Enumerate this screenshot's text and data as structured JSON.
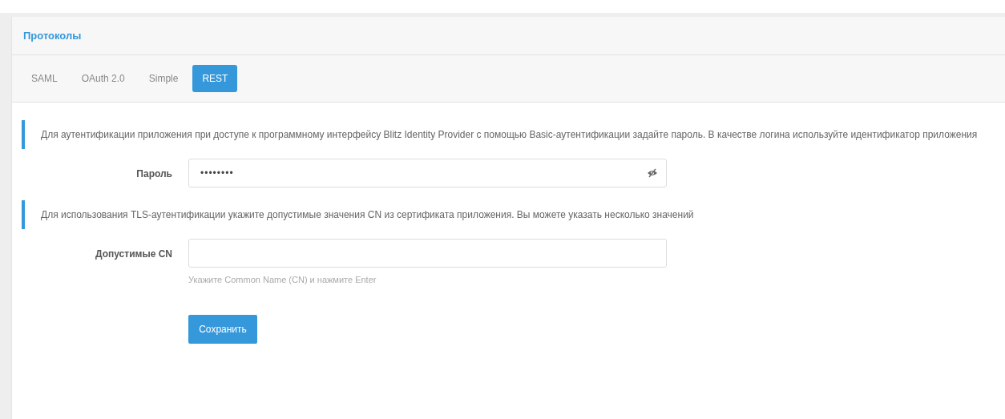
{
  "panel": {
    "title": "Протоколы"
  },
  "tabs": [
    {
      "label": "SAML",
      "selected": false
    },
    {
      "label": "OAuth 2.0",
      "selected": false
    },
    {
      "label": "Simple",
      "selected": false
    },
    {
      "label": "REST",
      "selected": true
    }
  ],
  "sections": [
    {
      "note": "Для аутентификации приложения при доступе к программному интерфейсу Blitz Identity Provider с помощью Basic-аутентификации задайте пароль. В качестве логина используйте идентификатор приложения",
      "field": {
        "kind": "password",
        "label": "Пароль",
        "value": "••••••••"
      }
    },
    {
      "note": "Для использования TLS-аутентификации укажите допустимые значения CN из сертификата приложения. Вы можете указать несколько значений",
      "field": {
        "kind": "text",
        "label": "Допустимые CN",
        "hint": "Укажите Common Name (CN) и нажмите Enter"
      }
    }
  ],
  "save_button": "Сохранить"
}
